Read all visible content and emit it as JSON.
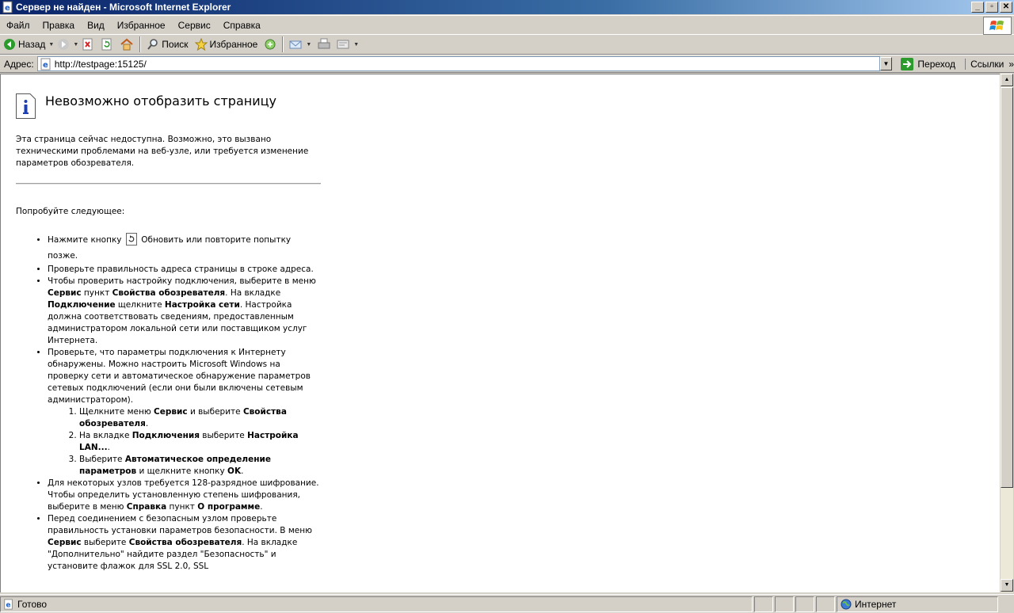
{
  "window": {
    "title": "Сервер не найден - Microsoft Internet Explorer",
    "controls": {
      "minimize": "_",
      "maximize": "▫",
      "close": "✕"
    }
  },
  "menu": [
    "Файл",
    "Правка",
    "Вид",
    "Избранное",
    "Сервис",
    "Справка"
  ],
  "toolbar": {
    "back_label": "Назад",
    "search_label": "Поиск",
    "favorites_label": "Избранное"
  },
  "address": {
    "label": "Адрес:",
    "url": "http://testpage:15125/",
    "go_label": "Переход",
    "links_label": "Ссылки",
    "links_chevron": "»"
  },
  "page": {
    "title": "Невозможно отобразить страницу",
    "intro": "Эта страница сейчас недоступна. Возможно, это вызвано техническими проблемами на веб-узле, или требуется изменение параметров обозревателя.",
    "try_label": "Попробуйте следующее:",
    "tip1_a": "Нажмите кнопку",
    "tip1_b": "Обновить или повторите попытку позже.",
    "tip2": "Проверьте правильность адреса страницы в строке адреса.",
    "tip3_a": "Чтобы проверить настройку подключения, выберите в меню ",
    "tip3_b": "Сервис",
    "tip3_c": " пункт ",
    "tip3_d": "Свойства обозревателя",
    "tip3_e": ". На вкладке ",
    "tip3_f": "Подключение",
    "tip3_g": " щелкните ",
    "tip3_h": "Настройка сети",
    "tip3_i": ". Настройка должна соответствовать сведениям, предоставленным администратором локальной сети или поставщиком услуг Интернета.",
    "tip4": "Проверьте, что параметры подключения к Интернету обнаружены. Можно настроить Microsoft Windows на проверку сети и автоматическое обнаружение параметров сетевых подключений (если они были включены сетевым администратором).",
    "step1_a": "Щелкните меню ",
    "step1_b": "Сервис",
    "step1_c": " и выберите ",
    "step1_d": "Свойства обозревателя",
    "step1_e": ".",
    "step2_a": "На вкладке ",
    "step2_b": "Подключения",
    "step2_c": " выберите ",
    "step2_d": "Настройка LAN...",
    "step2_e": ".",
    "step3_a": "Выберите ",
    "step3_b": "Автоматическое определение параметров",
    "step3_c": " и щелкните кнопку ",
    "step3_d": "OK",
    "step3_e": ".",
    "tip5_a": "Для некоторых узлов требуется 128-разрядное шифрование. Чтобы определить установленную степень шифрования, выберите в меню ",
    "tip5_b": "Справка",
    "tip5_c": " пункт ",
    "tip5_d": "О программе",
    "tip5_e": ".",
    "tip6_a": "Перед соединением с безопасным узлом проверьте правильность установки параметров безопасности. В меню ",
    "tip6_b": "Сервис",
    "tip6_c": " выберите ",
    "tip6_d": "Свойства обозревателя",
    "tip6_e": ". На вкладке \"Дополнительно\" найдите раздел \"Безопасность\" и установите флажок для SSL 2.0, SSL"
  },
  "status": {
    "text": "Готово",
    "zone": "Интернет"
  },
  "colors": {
    "title_bar": "#0a246a",
    "chrome": "#d4d0c8",
    "go_arrow": "#2d9a2d",
    "info_icon": "#1a3fb8"
  },
  "icons": [
    "ie-page-icon",
    "back-icon",
    "forward-icon",
    "stop-icon",
    "refresh-icon",
    "home-icon",
    "search-icon",
    "favorites-icon",
    "media-icon",
    "mail-icon",
    "print-icon",
    "edit-icon",
    "go-icon",
    "info-icon",
    "internet-zone-icon",
    "windows-logo-icon"
  ]
}
